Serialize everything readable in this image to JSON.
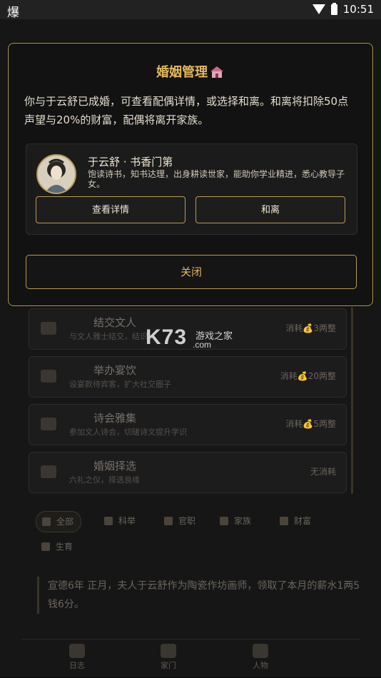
{
  "status_bar": {
    "app_icon_text": "爆",
    "time": "10:51"
  },
  "modal": {
    "title": "婚姻管理",
    "title_icon": "house-icon",
    "message": "你与于云舒已成婚，可查看配偶详情，或选择和离。和离将扣除50点声望与20%的财富，配偶将离开家族。",
    "spouse": {
      "name": "于云舒 · 书香门第",
      "description": "饱读诗书，知书达理，出身耕读世家，能助你学业精进，悉心教导子女。",
      "view_details_label": "查看详情",
      "divorce_label": "和离"
    },
    "close_label": "关闭",
    "accent_color": "#b89a56",
    "title_color": "#e3b65a"
  },
  "background": {
    "actions": [
      {
        "title": "结交文人",
        "desc": "与文人雅士结交，结识...",
        "cost": "消耗💰3两整"
      },
      {
        "title": "举办宴饮",
        "desc": "设宴款待宾客，扩大社交圈子",
        "cost": "消耗💰20两整"
      },
      {
        "title": "诗会雅集",
        "desc": "参加文人诗会，切磋诗文提升学识",
        "cost": "消耗💰5两整"
      },
      {
        "title": "婚姻择选",
        "desc": "六礼之仪，择选良缘",
        "cost": "无消耗"
      }
    ],
    "filters": [
      "全部",
      "科举",
      "官职",
      "家族",
      "财富",
      "生育"
    ],
    "log_text": "宣德6年 正月，夫人于云舒作为陶瓷作坊画师，领取了本月的薪水1两5钱6分。",
    "tabs": [
      "日志",
      "家门",
      "人物"
    ]
  },
  "watermark": {
    "logo": "K73",
    "cn": "游戏之家",
    "domain": ".com"
  }
}
